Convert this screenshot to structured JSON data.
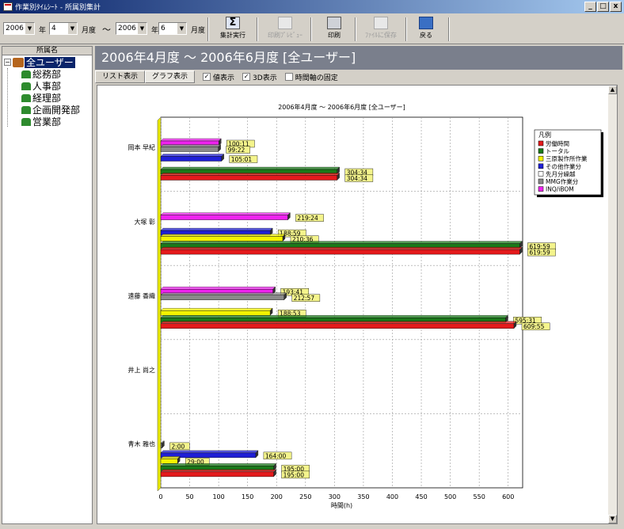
{
  "window": {
    "title": "作業別ﾀｲﾑｼｰﾄ - 所属別集計",
    "btn_min": "_",
    "btn_max": "□",
    "btn_close": "x"
  },
  "toolbar": {
    "from_year": "2006",
    "from_month": "4",
    "to_year": "2006",
    "to_month": "6",
    "year_label": "年",
    "month_label": "月度",
    "tilde": "～",
    "buttons": [
      {
        "label": "集計実行",
        "enabled": true
      },
      {
        "label": "印刷ﾌﾟﾚﾋﾞｭｰ",
        "enabled": false
      },
      {
        "label": "印刷",
        "enabled": true
      },
      {
        "label": "ﾌｧｲﾙに保存",
        "enabled": false
      },
      {
        "label": "戻る",
        "enabled": true
      }
    ]
  },
  "sidebar": {
    "header": "所属名",
    "root": "全ユーザー",
    "items": [
      "総務部",
      "人事部",
      "経理部",
      "企画開発部",
      "営業部"
    ]
  },
  "main": {
    "title": "2006年4月度 ～ 2006年6月度 [全ユーザー]"
  },
  "tabs": {
    "list": "リスト表示",
    "graph": "グラフ表示",
    "show_values": "値表示",
    "show_3d": "3D表示",
    "fix_time_axis": "時間軸の固定",
    "check": "✓"
  },
  "chart_data": {
    "type": "bar",
    "orientation": "horizontal",
    "title": "2006年4月度 ～ 2006年6月度 [全ユーザー]",
    "xlabel": "時間(h)",
    "xlim": [
      0,
      625
    ],
    "xticks": [
      0,
      50,
      100,
      150,
      200,
      250,
      300,
      350,
      400,
      450,
      500,
      550,
      600
    ],
    "grid": true,
    "legend_title": "凡例",
    "legend_position": "top-right",
    "series": [
      {
        "name": "労働時間",
        "color": "#e41a1c"
      },
      {
        "name": "トータル",
        "color": "#1a7a1a"
      },
      {
        "name": "三原製作所作業",
        "color": "#f2f200"
      },
      {
        "name": "その他作業分",
        "color": "#1f1fd6"
      },
      {
        "name": "先月分繰越",
        "color": "#ffffff"
      },
      {
        "name": "MMG作業分",
        "color": "#8a8a8a"
      },
      {
        "name": "INQ/iBOM",
        "color": "#ee22ee"
      }
    ],
    "categories": [
      {
        "name": "岡本 早紀",
        "bars": [
          {
            "s": 6,
            "value": 100.18,
            "label": "100:11"
          },
          {
            "s": 5,
            "value": 99.37,
            "label": "99:22"
          },
          {
            "s": 3,
            "value": 105.02,
            "label": "105:01"
          },
          {
            "s": 1,
            "value": 304.57,
            "label": "304:34"
          },
          {
            "s": 0,
            "value": 304.57,
            "label": "304:34"
          }
        ]
      },
      {
        "name": "大塚 彰",
        "bars": [
          {
            "s": 6,
            "value": 219.4,
            "label": "219:24"
          },
          {
            "s": 3,
            "value": 188.98,
            "label": "188:59"
          },
          {
            "s": 2,
            "value": 210.6,
            "label": "210:36"
          },
          {
            "s": 1,
            "value": 619.98,
            "label": "619:59"
          },
          {
            "s": 0,
            "value": 619.98,
            "label": "619:59"
          }
        ]
      },
      {
        "name": "遠藤 香織",
        "bars": [
          {
            "s": 6,
            "value": 193.68,
            "label": "193:41"
          },
          {
            "s": 5,
            "value": 212.95,
            "label": "212:57"
          },
          {
            "s": 2,
            "value": 188.88,
            "label": "188:53"
          },
          {
            "s": 1,
            "value": 595.52,
            "label": "595:31"
          },
          {
            "s": 0,
            "value": 609.92,
            "label": "609:55"
          }
        ]
      },
      {
        "name": "井上 尚之",
        "bars": []
      },
      {
        "name": "青木 雅也",
        "bars": [
          {
            "s": 5,
            "value": 2.0,
            "label": "2:00"
          },
          {
            "s": 3,
            "value": 164.0,
            "label": "164:00"
          },
          {
            "s": 2,
            "value": 29.0,
            "label": "29:00"
          },
          {
            "s": 1,
            "value": 195.0,
            "label": "195:00"
          },
          {
            "s": 0,
            "value": 195.0,
            "label": "195:00"
          }
        ]
      }
    ]
  }
}
